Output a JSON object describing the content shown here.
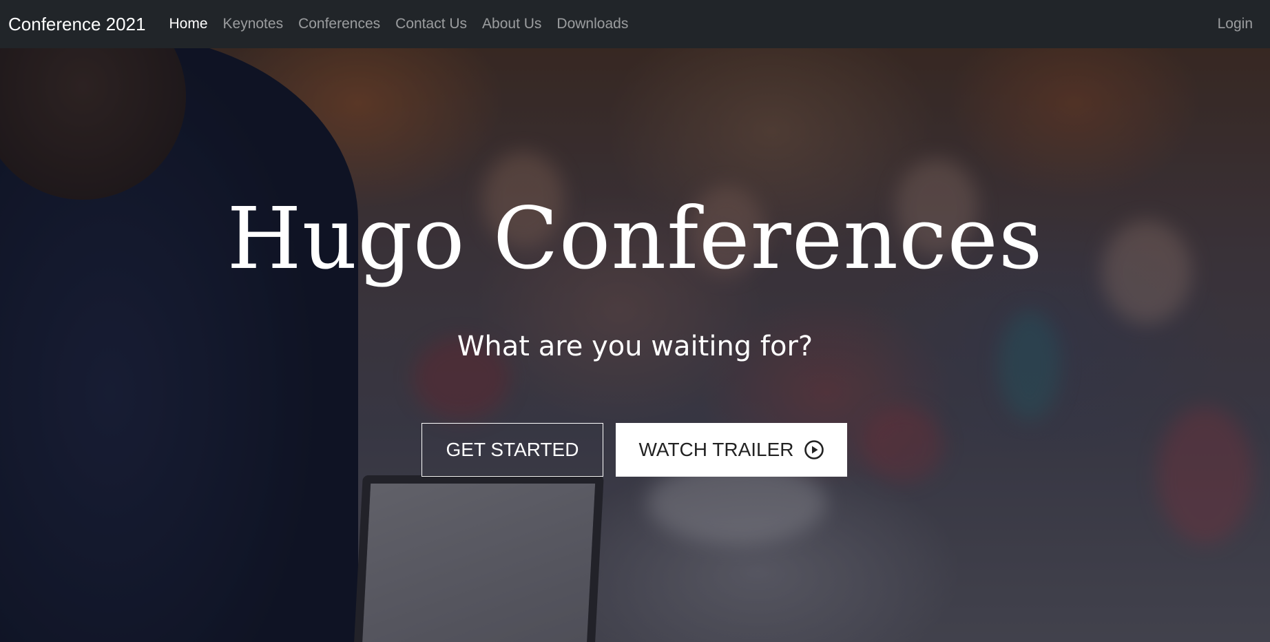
{
  "navbar": {
    "brand": "Conference 2021",
    "links": [
      {
        "label": "Home",
        "active": true
      },
      {
        "label": "Keynotes",
        "active": false
      },
      {
        "label": "Conferences",
        "active": false
      },
      {
        "label": "Contact Us",
        "active": false
      },
      {
        "label": "About Us",
        "active": false
      },
      {
        "label": "Downloads",
        "active": false
      }
    ],
    "login": "Login"
  },
  "hero": {
    "title": "Hugo Conferences",
    "subtitle": "What are you waiting for?",
    "get_started_label": "GET STARTED",
    "watch_trailer_label": "WATCH TRAILER",
    "watch_trailer_icon": "play-circle-icon"
  },
  "colors": {
    "navbar_bg": "#212529",
    "text_white": "#ffffff",
    "nav_inactive": "rgba(255,255,255,0.55)"
  }
}
